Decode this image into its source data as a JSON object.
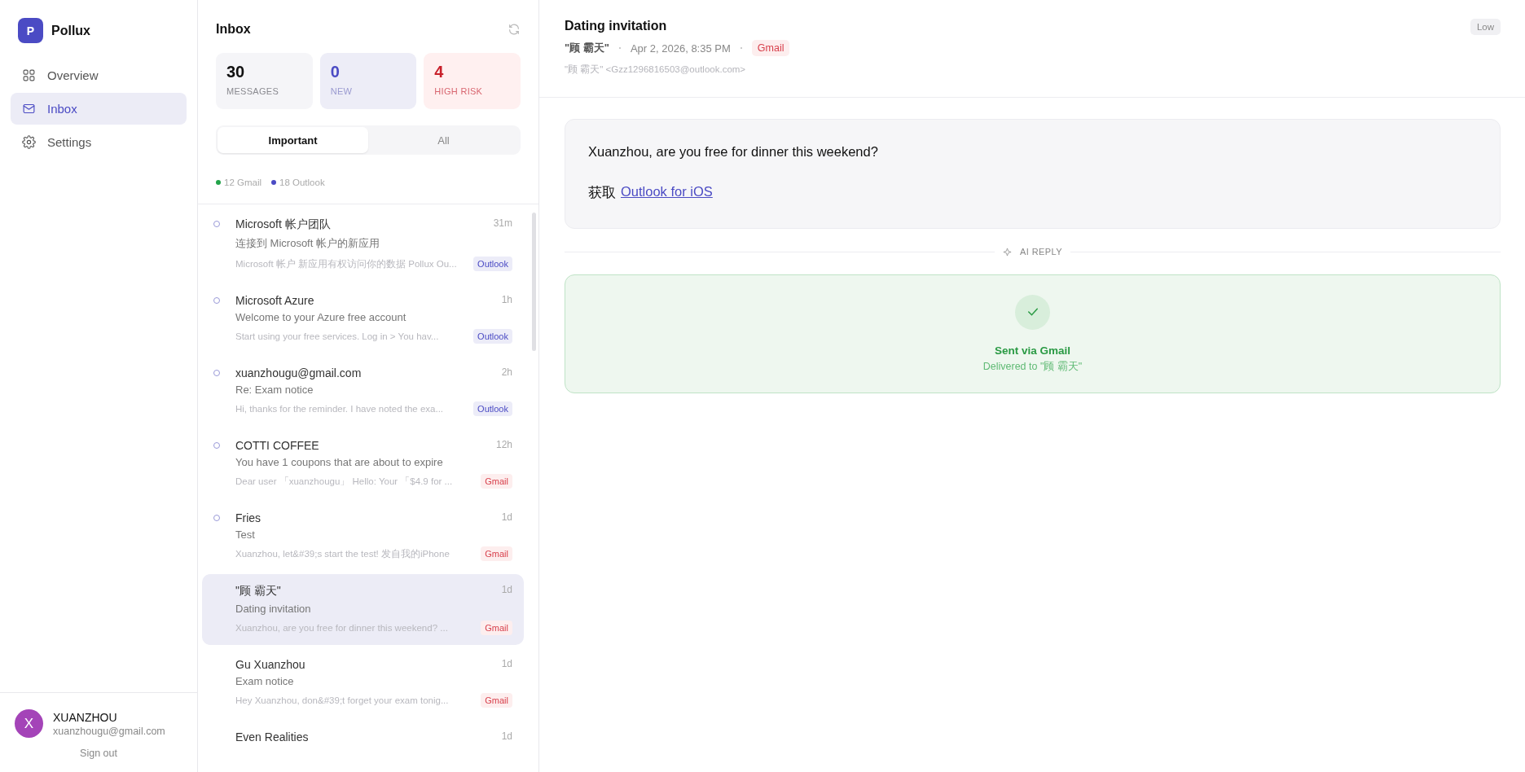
{
  "app": {
    "logo_letter": "P",
    "name": "Pollux"
  },
  "nav": [
    {
      "label": "Overview",
      "kind": "overview",
      "selected": false
    },
    {
      "label": "Inbox",
      "kind": "inbox",
      "selected": true
    },
    {
      "label": "Settings",
      "kind": "settings",
      "selected": false
    }
  ],
  "user": {
    "initial": "X",
    "name": "XUANZHOU",
    "email": "xuanzhougu@gmail.com",
    "sign_out": "Sign out"
  },
  "inbox": {
    "title": "Inbox",
    "stats": [
      {
        "value": "30",
        "label": "MESSAGES",
        "kind": "total"
      },
      {
        "value": "0",
        "label": "NEW",
        "kind": "new"
      },
      {
        "value": "4",
        "label": "HIGH RISK",
        "kind": "risk"
      }
    ],
    "tabs": [
      {
        "label": "Important",
        "selected": true
      },
      {
        "label": "All",
        "selected": false
      }
    ],
    "legend": [
      {
        "label": "12 Gmail",
        "color": "#22a34a"
      },
      {
        "label": "18 Outlook",
        "color": "#4b4bc4"
      }
    ],
    "messages": [
      {
        "sender": "Microsoft 帐户团队",
        "time": "31m",
        "subject": "连接到 Microsoft 帐户的新应用",
        "preview": "Microsoft 帐户 新应用有权访问你的数据 Pollux Ou...",
        "tag": {
          "label": "Outlook",
          "kind": "outlook"
        },
        "unread": true,
        "selected": false
      },
      {
        "sender": "Microsoft Azure",
        "time": "1h",
        "subject": "Welcome to your Azure free account",
        "preview": "Start using your free services. Log in > You hav...",
        "tag": {
          "label": "Outlook",
          "kind": "outlook"
        },
        "unread": true,
        "selected": false
      },
      {
        "sender": "xuanzhougu@gmail.com",
        "time": "2h",
        "subject": "Re: Exam notice",
        "preview": "Hi, thanks for the reminder. I have noted the exa...",
        "tag": {
          "label": "Outlook",
          "kind": "outlook"
        },
        "unread": true,
        "selected": false
      },
      {
        "sender": "COTTI COFFEE",
        "time": "12h",
        "subject": "You have 1 coupons that are about to expire",
        "preview": "Dear user 「xuanzhougu」 Hello: Your 「$4.9 for ...",
        "tag": {
          "label": "Gmail",
          "kind": "gmail"
        },
        "unread": true,
        "selected": false
      },
      {
        "sender": "Fries",
        "time": "1d",
        "subject": "Test",
        "preview": "Xuanzhou, let&#39;s start the test! 发自我的iPhone",
        "tag": {
          "label": "Gmail",
          "kind": "gmail"
        },
        "unread": true,
        "selected": false
      },
      {
        "sender": "\"顾 霸天\"",
        "time": "1d",
        "subject": "Dating invitation",
        "preview": "Xuanzhou, are you free for dinner this weekend? ...",
        "tag": {
          "label": "Gmail",
          "kind": "gmail"
        },
        "unread": false,
        "selected": true
      },
      {
        "sender": "Gu Xuanzhou",
        "time": "1d",
        "subject": "Exam notice",
        "preview": "Hey Xuanzhou, don&#39;t forget your exam tonig...",
        "tag": {
          "label": "Gmail",
          "kind": "gmail"
        },
        "unread": false,
        "selected": false
      },
      {
        "sender": "Even Realities",
        "time": "1d",
        "unread": false,
        "selected": false
      }
    ]
  },
  "detail": {
    "title": "Dating invitation",
    "sender": "\"顾 霸天\"",
    "date": "Apr 2, 2026, 8:35 PM",
    "tag": {
      "label": "Gmail",
      "kind": "gmail"
    },
    "address": "\"顾 霸天\" <Gzz1296816503@outlook.com>",
    "priority": "Low",
    "body": [
      {
        "text": "Xuanzhou, are you free for dinner this weekend?"
      },
      {
        "text": "获取",
        "link": "Outlook for iOS"
      }
    ],
    "divider": "AI REPLY",
    "reply": {
      "title": "Sent via Gmail",
      "subtitle": "Delivered to \"顾 霸天\""
    }
  }
}
